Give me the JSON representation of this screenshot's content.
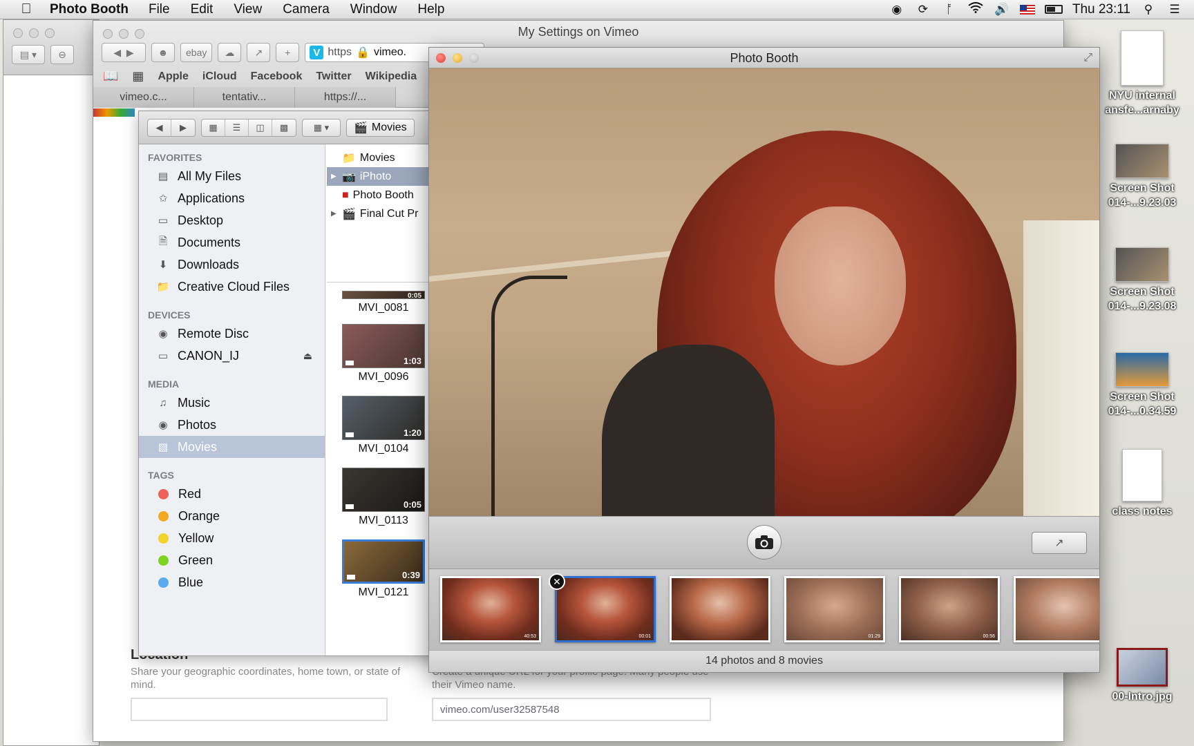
{
  "menubar": {
    "app_name": "Photo Booth",
    "menus": [
      "File",
      "Edit",
      "View",
      "Camera",
      "Window",
      "Help"
    ],
    "clock": "Thu 23:11"
  },
  "safari": {
    "title": "My Settings on Vimeo",
    "url_scheme": "https",
    "url_host": "vimeo.",
    "toolbar_ebay": "ebay",
    "bookmarks": [
      "Apple",
      "iCloud",
      "Facebook",
      "Twitter",
      "Wikipedia"
    ],
    "tabs": [
      "vimeo.c...",
      "tentativ...",
      "https://..."
    ],
    "location_heading": "Location",
    "location_desc": "Share your geographic coordinates, home town, or state of mind.",
    "url_desc": "Create a unique URL for your profile page. Many people use their Vimeo name.",
    "profile_url": "vimeo.com/user32587548"
  },
  "finder": {
    "path_label": "Movies",
    "favorites_header": "FAVORITES",
    "favorites": [
      "All My Files",
      "Applications",
      "Desktop",
      "Documents",
      "Downloads",
      "Creative Cloud Files"
    ],
    "devices_header": "DEVICES",
    "devices": [
      "Remote Disc",
      "CANON_IJ"
    ],
    "media_header": "MEDIA",
    "media": [
      "Music",
      "Photos",
      "Movies"
    ],
    "tags_header": "TAGS",
    "tags": [
      {
        "name": "Red",
        "color": "#f0605a"
      },
      {
        "name": "Orange",
        "color": "#f5a623"
      },
      {
        "name": "Yellow",
        "color": "#f2d32c"
      },
      {
        "name": "Green",
        "color": "#7ed321"
      },
      {
        "name": "Blue",
        "color": "#5aaaf0"
      }
    ],
    "column_items": [
      "Movies",
      "iPhoto",
      "Photo Booth",
      "Final Cut Pr"
    ],
    "movies": [
      {
        "name": "MVI_0081",
        "duration": "0:05"
      },
      {
        "name": "MVI_0096",
        "duration": "1:03"
      },
      {
        "name": "MVI_0104",
        "duration": "1:20"
      },
      {
        "name": "MVI_0113",
        "duration": "0:05"
      },
      {
        "name": "MVI_0121",
        "duration": "0:39"
      }
    ]
  },
  "photobooth": {
    "title": "Photo Booth",
    "footer": "14 photos and 8 movies",
    "selected_index": 1,
    "thumb_marks": [
      "40:53",
      "00:01",
      "",
      "01:29",
      "00:56",
      ""
    ]
  },
  "desktop": {
    "items": [
      {
        "label_1": "NYU internal",
        "label_2": "ansfe...arnaby"
      },
      {
        "label_1": "Screen Shot",
        "label_2": "014-...9.23.03"
      },
      {
        "label_1": "Screen Shot",
        "label_2": "014-...9.23.08"
      },
      {
        "label_1": "Screen Shot",
        "label_2": "014-...0.34.59"
      },
      {
        "label_1": "class notes",
        "label_2": ""
      },
      {
        "label_1": "00-Intro.jpg",
        "label_2": ""
      }
    ]
  },
  "colors": {
    "selection_blue": "#2f6fd0",
    "vimeo_blue": "#1ab7ea",
    "traffic_red": "#e0443e",
    "traffic_yellow": "#e5a82d"
  }
}
